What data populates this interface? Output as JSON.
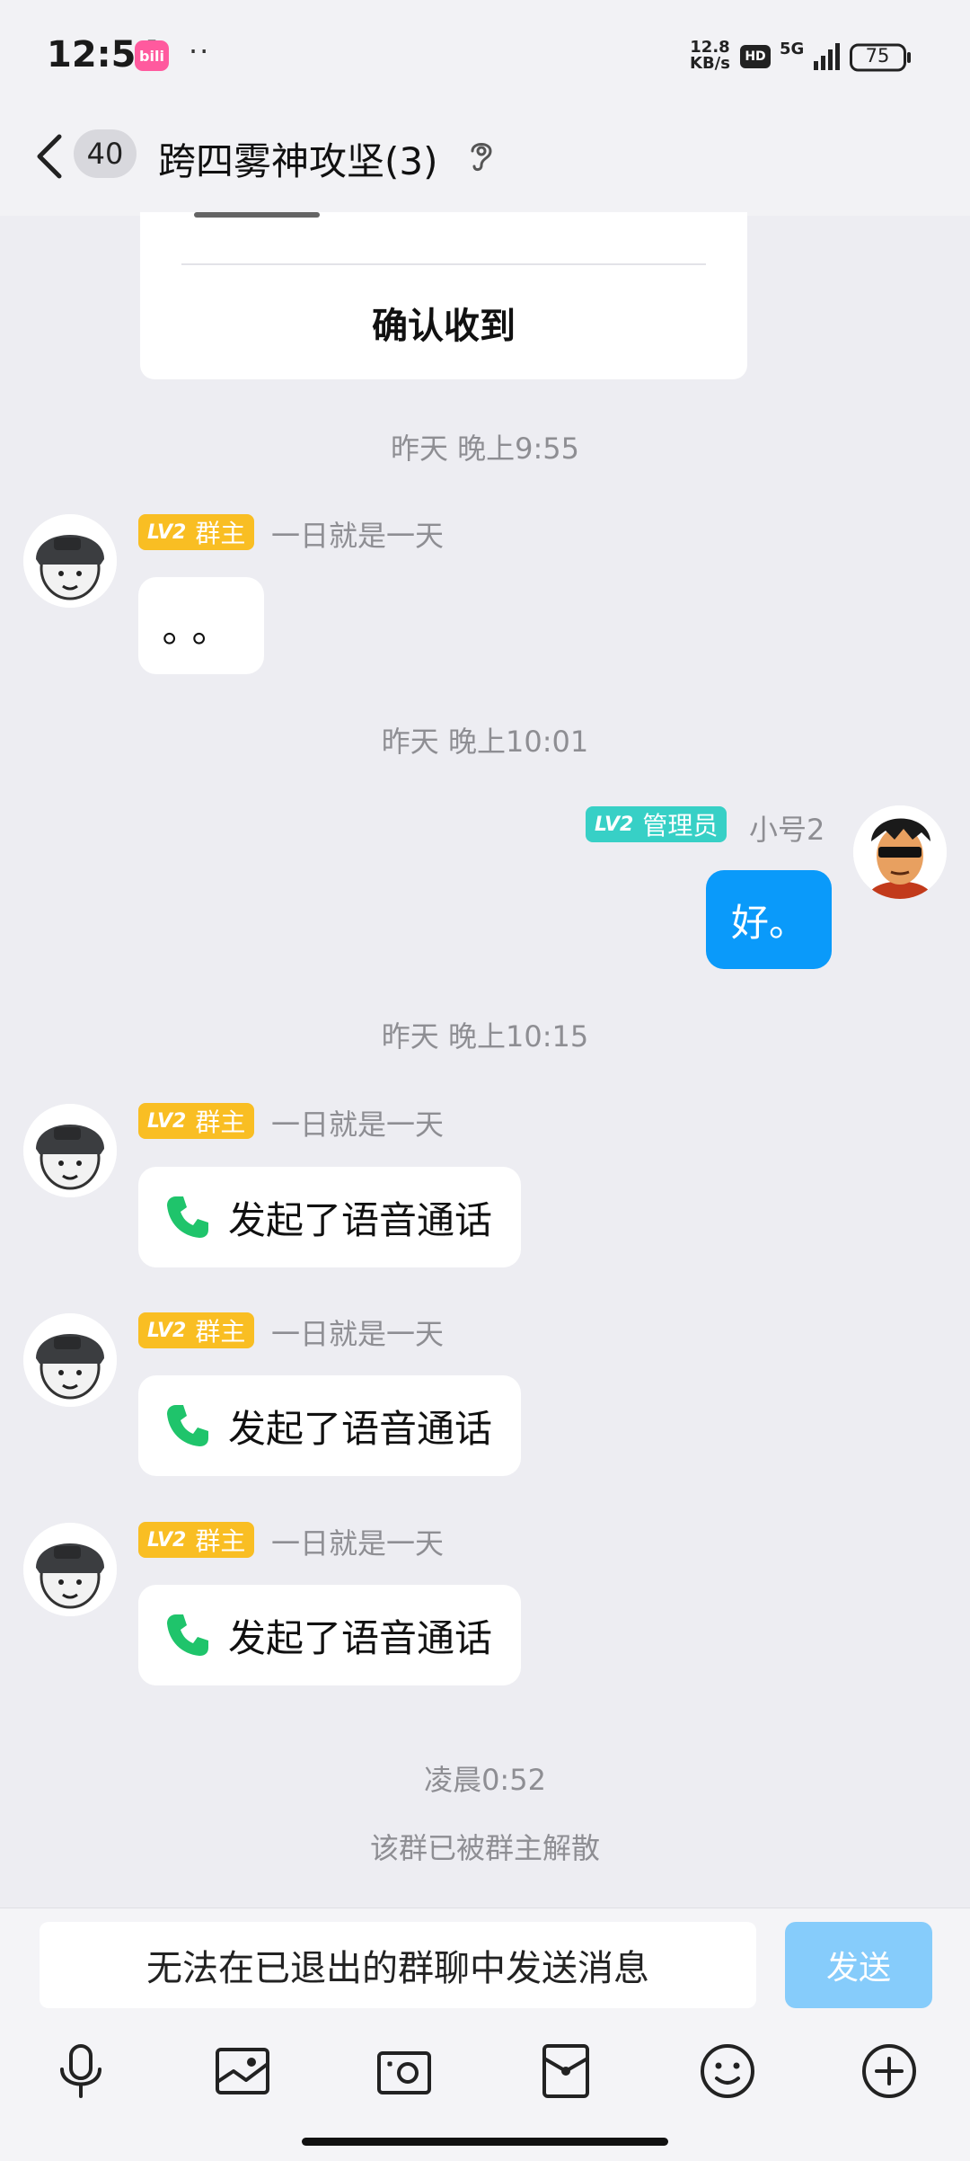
{
  "status_bar": {
    "time": "12:54",
    "app_badge": "bili",
    "dots": "··",
    "speed_value": "12.8",
    "speed_unit": "KB/s",
    "hd": "HD",
    "network": "5G",
    "battery": "75"
  },
  "header": {
    "unread_count": "40",
    "title": "跨四雾神攻坚(3)"
  },
  "card": {
    "confirm_label": "确认收到"
  },
  "messages": [
    {
      "type": "time",
      "text": "昨天 晚上9:55"
    },
    {
      "type": "msg",
      "side": "left",
      "level": "LV2",
      "role": "群主",
      "sender": "一日就是一天",
      "text": "。。"
    },
    {
      "type": "time",
      "text": "昨天 晚上10:01"
    },
    {
      "type": "msg",
      "side": "right",
      "level": "LV2",
      "role": "管理员",
      "sender": "小号2",
      "text": "好。"
    },
    {
      "type": "time",
      "text": "昨天 晚上10:15"
    },
    {
      "type": "call",
      "side": "left",
      "level": "LV2",
      "role": "群主",
      "sender": "一日就是一天",
      "text": "发起了语音通话"
    },
    {
      "type": "call",
      "side": "left",
      "level": "LV2",
      "role": "群主",
      "sender": "一日就是一天",
      "text": "发起了语音通话"
    },
    {
      "type": "call",
      "side": "left",
      "level": "LV2",
      "role": "群主",
      "sender": "一日就是一天",
      "text": "发起了语音通话"
    },
    {
      "type": "time",
      "text": "凌晨0:52"
    },
    {
      "type": "system",
      "text": "该群已被群主解散"
    }
  ],
  "input": {
    "placeholder": "无法在已退出的群聊中发送消息",
    "send_label": "发送"
  },
  "toolbar": [
    "mic-icon",
    "image-icon",
    "camera-icon",
    "red-packet-icon",
    "emoji-icon",
    "plus-icon"
  ],
  "colors": {
    "accent": "#0a9afa",
    "owner_badge": "#f9be23",
    "admin_badge": "#37d0c6",
    "call_green": "#1fc46b",
    "send_disabled": "#86ccfb"
  }
}
